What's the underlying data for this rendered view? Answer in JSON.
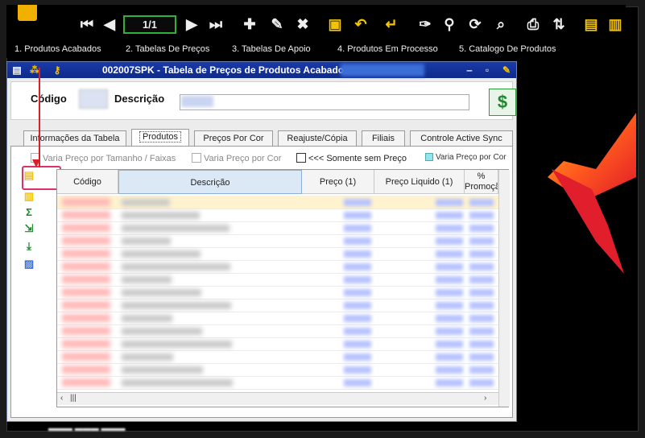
{
  "toolbar": {
    "pager_value": "1/1",
    "icons": [
      "first-icon",
      "prev-icon",
      "next-icon",
      "last-icon",
      "add-icon",
      "edit-icon",
      "delete-icon",
      "save-icon",
      "undo-icon",
      "confirm-icon",
      "clear-icon",
      "search-icon",
      "refresh-icon",
      "preview-icon",
      "print-icon",
      "sort-icon",
      "add-doc-icon",
      "remove-doc-icon"
    ]
  },
  "menu": {
    "items": [
      "1. Produtos Acabados",
      "2. Tabelas De Preços",
      "3. Tabelas De Apoio",
      "4. Produtos Em Processo",
      "5. Catalogo De Produtos"
    ]
  },
  "window": {
    "title": "002007SPK - Tabela de Preços de Produtos Acabados",
    "codigo_label": "Código",
    "descricao_label": "Descrição"
  },
  "tabs": [
    "Informações da Tabela",
    "Produtos",
    "Preços Por Cor",
    "Reajuste/Cópia",
    "Filiais",
    "Controle Active Sync"
  ],
  "filters": {
    "varia_tamanho": "Varia Preço por Tamanho / Faixas",
    "varia_cor": "Varia Preço por Cor",
    "somente_sem_preco": "<<< Somente sem Preço",
    "legend_cor": "Varia Preço por Cor"
  },
  "grid": {
    "columns": [
      "Código",
      "Descrição",
      "Preço (1)",
      "Preço Liquido (1)",
      "% Promoção"
    ],
    "row_count": 15
  },
  "colors": {
    "accent_green": "#2fb13a",
    "title_blue": "#1a3aa8",
    "highlight_red": "#e0306a",
    "toolbar_yellow": "#f5c400"
  }
}
